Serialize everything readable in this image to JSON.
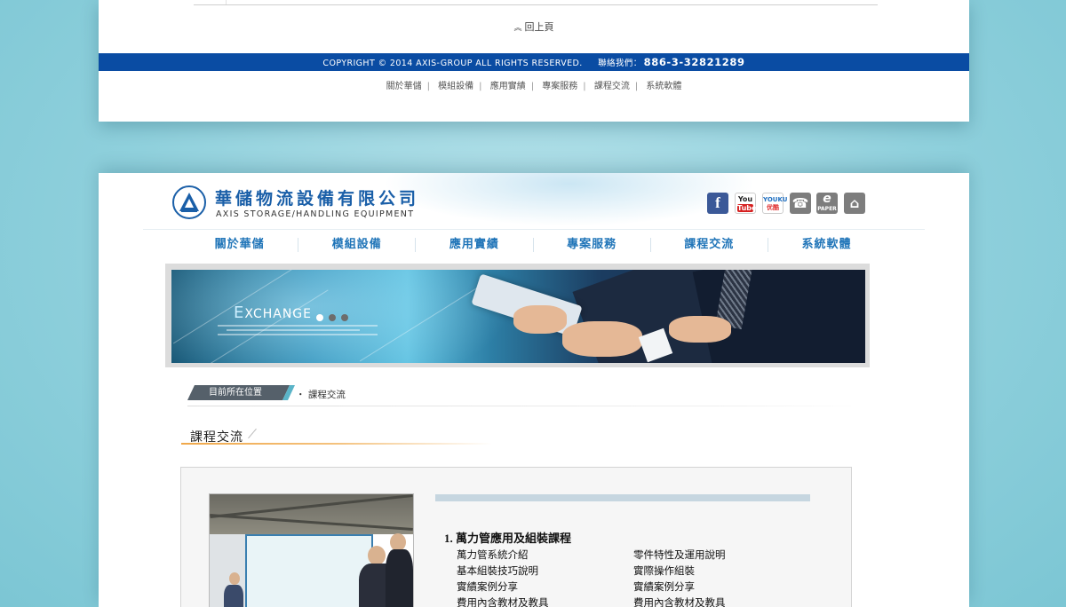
{
  "footer": {
    "back_top": "回上頁",
    "copyright": "COPYRIGHT © 2014 AXIS-GROUP ALL RIGHTS RESERVED.",
    "contact_label": "聯絡我們：",
    "phone": "886-3-32821289",
    "links": [
      "關於華儲",
      "模組設備",
      "應用實績",
      "專案服務",
      "課程交流",
      "系統軟體"
    ]
  },
  "header": {
    "company_cn": "華儲物流設備有限公司",
    "company_en": "AXIS STORAGE/HANDLING EQUIPMENT",
    "logo_text": "AXIS",
    "social": {
      "facebook": "f",
      "youtube_top": "You",
      "youtube_bottom": "Tube",
      "youku_top": "YOUKU",
      "youku_bottom": "优酷",
      "epaper_top": "e",
      "epaper_bottom": "PAPER"
    },
    "icons": [
      "facebook-icon",
      "youtube-icon",
      "youku-icon",
      "phone-icon",
      "epaper-icon",
      "home-icon"
    ]
  },
  "nav": {
    "items": [
      "關於華儲",
      "模組設備",
      "應用實績",
      "專案服務",
      "課程交流",
      "系統軟體"
    ]
  },
  "banner": {
    "title_first": "E",
    "title_rest": "XCHANGE"
  },
  "breadcrumb": {
    "label": "目前所在位置",
    "current": "・ 課程交流"
  },
  "section": {
    "title": "課程交流"
  },
  "course": {
    "title": "1. 萬力管應用及組裝課程",
    "left": [
      "萬力管系統介紹",
      "基本組裝技巧說明",
      "實績案例分享",
      "費用內含教材及教具"
    ],
    "right": [
      "零件特性及運用說明",
      "實際操作組裝",
      "實績案例分享",
      "費用內含教材及教具"
    ]
  },
  "colors": {
    "brand_blue": "#0a4ca3",
    "nav_blue": "#1f74b8",
    "accent_orange": "#f0a84a",
    "background": "#8fd0dc"
  }
}
